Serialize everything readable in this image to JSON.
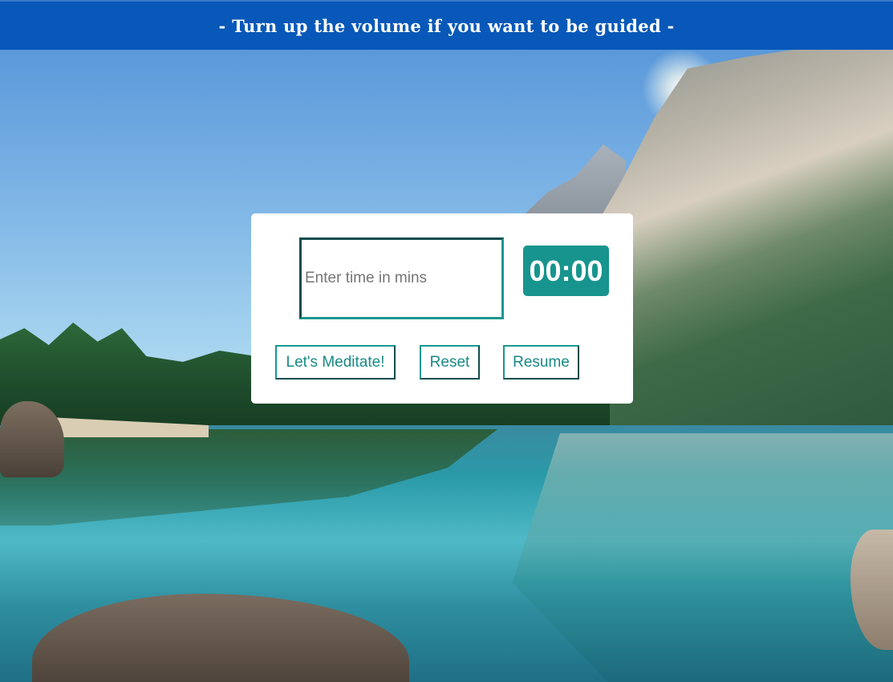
{
  "banner": {
    "text": "- Turn up the volume if you want to be guided -"
  },
  "timer": {
    "input_placeholder": "Enter time in mins",
    "input_value": "",
    "display": "00:00"
  },
  "buttons": {
    "meditate_label": "Let's Meditate!",
    "reset_label": "Reset",
    "resume_label": "Resume"
  },
  "colors": {
    "banner_bg": "#0758b8",
    "accent": "#17948e",
    "accent_dark": "#0f4d4c",
    "card_bg": "#ffffff"
  }
}
